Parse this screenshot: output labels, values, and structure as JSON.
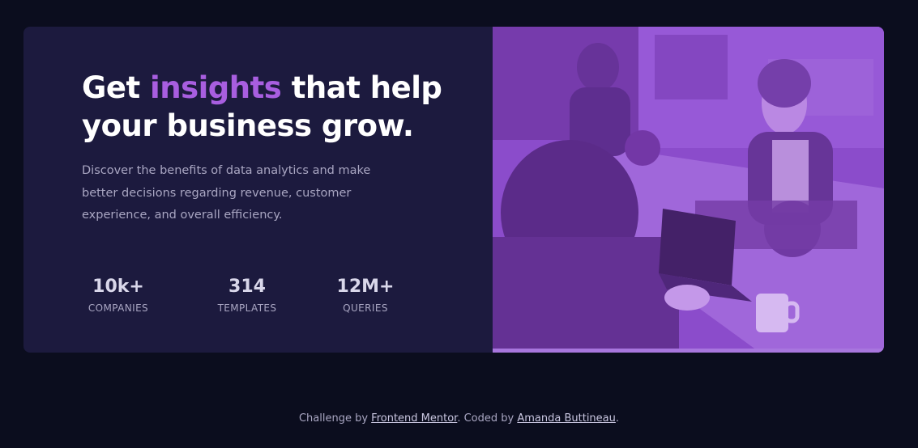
{
  "hero": {
    "heading_pre": "Get ",
    "heading_accent": "insights",
    "heading_post": " that help your business grow.",
    "description": "Discover the benefits of data analytics and make better decisions regarding revenue, customer experience, and overall efficiency."
  },
  "stats": [
    {
      "value": "10k+",
      "label": "COMPANIES"
    },
    {
      "value": "314",
      "label": "TEMPLATES"
    },
    {
      "value": "12M+",
      "label": "QUERIES"
    }
  ],
  "footer": {
    "prefix": "Challenge by ",
    "link1": "Frontend Mentor",
    "middle": ". Coded by ",
    "link2": "Amanda Buttineau",
    "suffix": "."
  },
  "colors": {
    "page_bg": "#0b0d1e",
    "card_bg": "#1c1a3e",
    "accent": "#a85ee0",
    "image_tint": "#8e4ed4"
  }
}
